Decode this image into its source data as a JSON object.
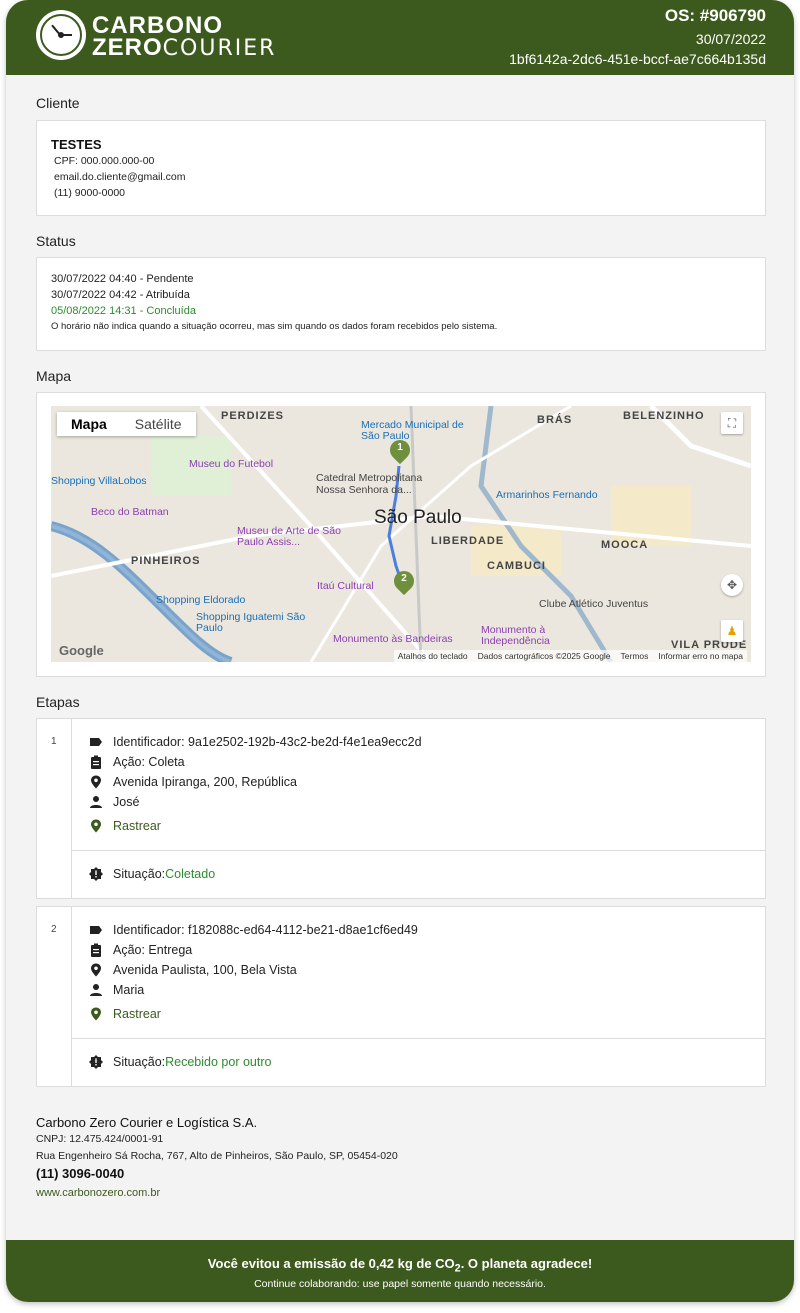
{
  "header": {
    "brand_line1": "CARBONO",
    "brand_line2_bold": "ZERO",
    "brand_line2_light": "COURIER",
    "os_number": "OS: #906790",
    "date": "30/07/2022",
    "hash": "1bf6142a-2dc6-451e-bccf-ae7c664b135d"
  },
  "client": {
    "section_title": "Cliente",
    "name": "TESTES",
    "cpf": "CPF: 000.000.000-00",
    "email": "email.do.cliente@gmail.com",
    "phone": "(11) 9000-0000"
  },
  "status": {
    "section_title": "Status",
    "entries": [
      "30/07/2022 04:40 - Pendente",
      "30/07/2022 04:42 - Atribuída",
      "05/08/2022 14:31 - Concluída"
    ],
    "note": "O horário não indica quando a situação ocorreu, mas sim quando os dados foram recebidos pelo sistema.",
    "green_color": "#2e8b2e"
  },
  "map": {
    "section_title": "Mapa",
    "tab_map": "Mapa",
    "tab_satellite": "Satélite",
    "city_label": "São Paulo",
    "labels": [
      "PERDIZES",
      "BRÁS",
      "BELENZINHO",
      "Mercado Municipal de São Paulo",
      "Museu do Futebol",
      "Catedral Metropolitana Nossa Senhora da...",
      "Armarinhos Fernando",
      "Beco do Batman",
      "Museu de Arte de São Paulo Assis...",
      "LIBERDADE",
      "MOOCA",
      "PINHEIROS",
      "CAMBUCI",
      "Itaú Cultural",
      "Shopping Eldorado",
      "Clube Atlético Juventus",
      "Shopping Iguatemi São Paulo",
      "Monumento às Bandeiras",
      "Monumento à Independência",
      "VILA PRUDE",
      "Shopping VillaLobos"
    ],
    "marker1": "1",
    "marker2": "2",
    "google": "Google",
    "footer_links": [
      "Atalhos do teclado",
      "Dados cartográficos ©2025 Google",
      "Termos",
      "Informar erro no mapa"
    ]
  },
  "steps": {
    "section_title": "Etapas",
    "items": [
      {
        "number": "1",
        "identifier": "Identificador: 9a1e2502-192b-43c2-be2d-f4e1ea9ecc2d",
        "action": "Ação: Coleta",
        "address": "Avenida Ipiranga, 200, República",
        "person": "José",
        "track": "Rastrear",
        "situation_label": "Situação: ",
        "situation_value": "Coletado"
      },
      {
        "number": "2",
        "identifier": "Identificador: f182088c-ed64-4112-be21-d8ae1cf6ed49",
        "action": "Ação: Entrega",
        "address": "Avenida Paulista, 100, Bela Vista",
        "person": "Maria",
        "track": "Rastrear",
        "situation_label": "Situação: ",
        "situation_value": "Recebido por outro"
      }
    ]
  },
  "footer": {
    "company": "Carbono Zero Courier e Logística S.A.",
    "cnpj": "CNPJ: 12.475.424/0001-91",
    "address": "Rua Engenheiro Sá Rocha, 767, Alto de Pinheiros, São Paulo, SP, 05454-020",
    "phone": "(11) 3096-0040",
    "website": "www.carbonozero.com.br"
  },
  "bottom_bar": {
    "line1_prefix": "Você evitou a emissão de 0,42 kg de CO",
    "line1_sub": "2",
    "line1_suffix": ". O planeta agradece!",
    "line2": "Continue colaborando: use papel somente quando necessário."
  },
  "colors": {
    "brand_green": "#3d5a1e",
    "status_green": "#2e8b2e",
    "background": "#f3f3f3"
  }
}
